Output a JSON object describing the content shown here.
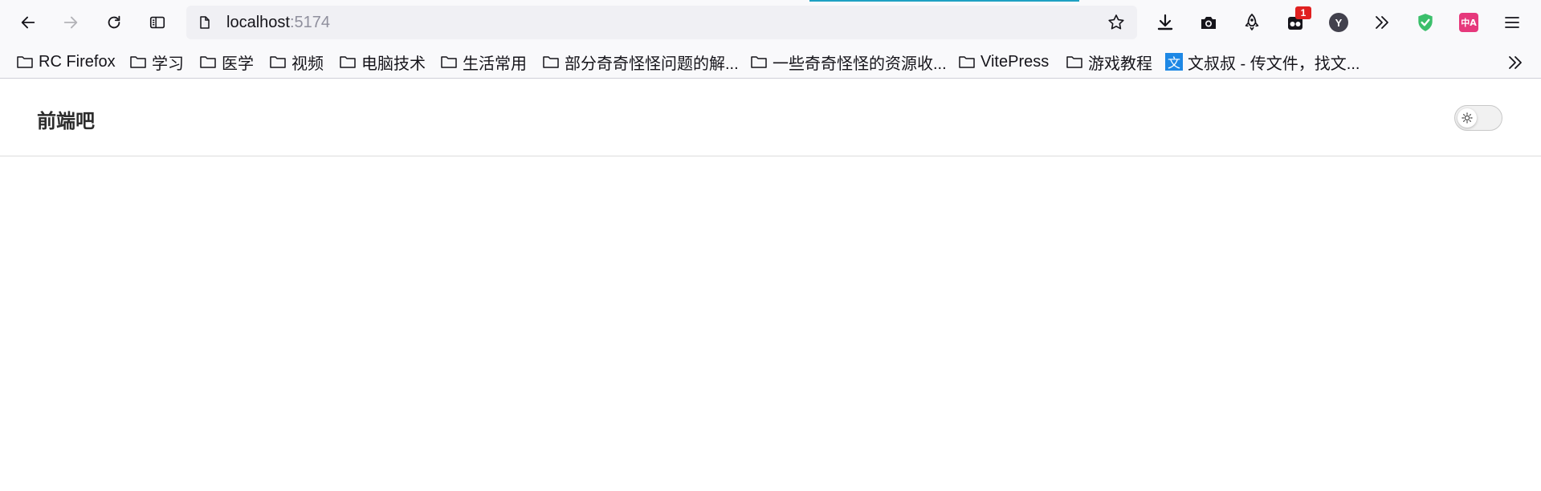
{
  "browser": {
    "url_host": "localhost",
    "url_port": ":5174",
    "extension_badge": "1",
    "profile_letter": "Y",
    "translate_glyph": "中A",
    "icons": {
      "back": "arrow-left-icon",
      "forward": "arrow-right-icon",
      "reload": "reload-icon",
      "sidebar": "sidebar-icon",
      "page": "page-icon",
      "bookmark_star": "star-icon",
      "download": "download-icon",
      "screenshot": "camera-icon",
      "rocket": "rocket-icon",
      "extension": "extension-icon",
      "profile": "profile-icon",
      "more_tools": "double-chevron-icon",
      "shield": "shield-check-icon",
      "translate": "translate-icon",
      "menu": "hamburger-icon"
    },
    "accent_colors": {
      "loading_line": "#1ea1c3",
      "badge": "#e02020",
      "shield": "#3bbf6b",
      "translate": "#e6397c"
    }
  },
  "bookmarks": {
    "items": [
      {
        "label": "RC Firefox",
        "icon": "folder-icon"
      },
      {
        "label": "学习",
        "icon": "folder-icon"
      },
      {
        "label": "医学",
        "icon": "folder-icon"
      },
      {
        "label": "视频",
        "icon": "folder-icon"
      },
      {
        "label": "电脑技术",
        "icon": "folder-icon"
      },
      {
        "label": "生活常用",
        "icon": "folder-icon"
      },
      {
        "label": "部分奇奇怪怪问题的解...",
        "icon": "folder-icon"
      },
      {
        "label": "一些奇奇怪怪的资源收...",
        "icon": "folder-icon"
      },
      {
        "label": "VitePress",
        "icon": "folder-icon"
      },
      {
        "label": "游戏教程",
        "icon": "folder-icon"
      },
      {
        "label": "文叔叔 - 传文件，找文...",
        "icon": "wenshushu-icon"
      }
    ],
    "wenshu_glyph": "文"
  },
  "page": {
    "site_title": "前端吧",
    "theme_switch_icon": "sun-icon"
  }
}
